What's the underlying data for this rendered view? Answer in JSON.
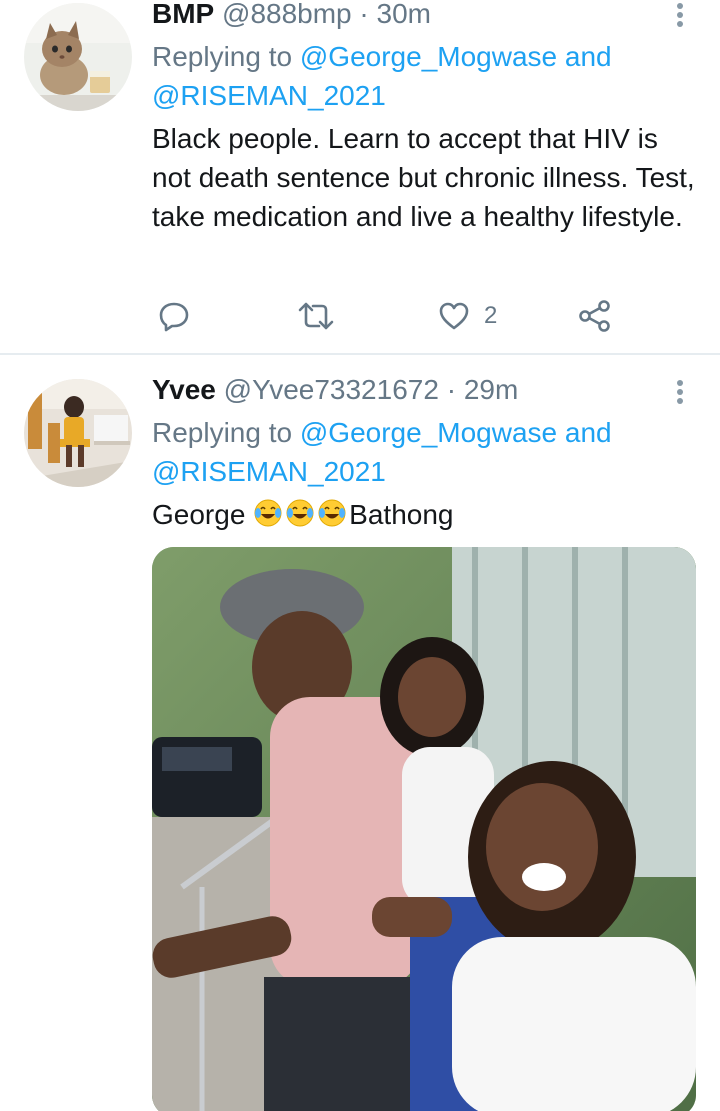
{
  "tweets": [
    {
      "name": "BMP",
      "handle": "@888bmp",
      "time": "30m",
      "replying_prefix": "Replying to",
      "mention1": "@George_Mogwase",
      "and": "and",
      "mention2": "@RISEMAN_2021",
      "text": "Black people. Learn to accept that HIV is not death sentence but chronic illness. Test, take medication and live a healthy lifestyle.",
      "like_count": "2"
    },
    {
      "name": "Yvee",
      "handle": "@Yvee73321672",
      "time": "29m",
      "replying_prefix": "Replying to",
      "mention1": "@George_Mogwase",
      "and": "and",
      "mention2": "@RISEMAN_2021",
      "text_before": "George ",
      "text_after": "Bathong",
      "emoji_name": "face-with-tears-of-joy",
      "emoji_count": 3
    }
  ],
  "icons": {
    "reply": "reply-icon",
    "retweet": "retweet-icon",
    "like": "heart-icon",
    "share": "share-icon",
    "more": "more-vertical-icon"
  },
  "colors": {
    "link": "#1da1f2",
    "secondary_text": "#657786",
    "primary_text": "#14171a",
    "icon": "#657786",
    "divider": "#e6ecf0"
  }
}
